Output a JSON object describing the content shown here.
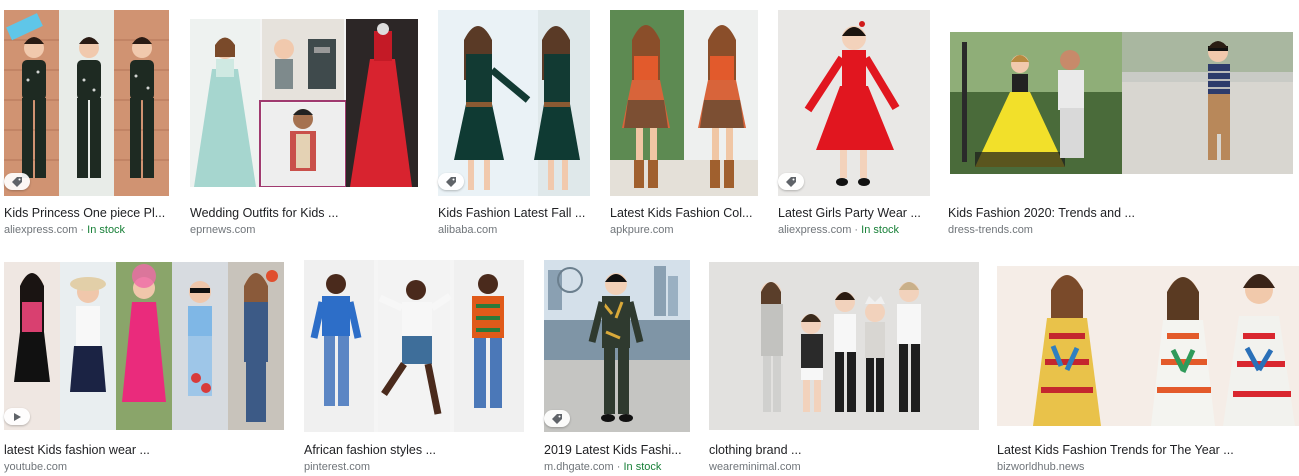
{
  "colors": {
    "title_text": "#202124",
    "source_text": "#70757a",
    "in_stock": "#188038"
  },
  "results": [
    {
      "title": "Kids Princess One piece Pl...",
      "source": "aliexpress.com",
      "availability": "In stock",
      "badge": "tag-icon"
    },
    {
      "title": "Wedding Outfits for Kids ...",
      "source": "eprnews.com"
    },
    {
      "title": "Kids Fashion Latest Fall ...",
      "source": "alibaba.com",
      "badge": "tag-icon"
    },
    {
      "title": "Latest Kids Fashion Col...",
      "source": "apkpure.com"
    },
    {
      "title": "Latest Girls Party Wear ...",
      "source": "aliexpress.com",
      "availability": "In stock",
      "badge": "tag-icon"
    },
    {
      "title": "Kids Fashion 2020: Trends and ...",
      "source": "dress-trends.com"
    },
    {
      "title": "latest Kids fashion wear ...",
      "source": "youtube.com",
      "badge": "play-icon"
    },
    {
      "title": "African fashion styles ...",
      "source": "pinterest.com"
    },
    {
      "title": "2019 Latest Kids Fashi...",
      "source": "m.dhgate.com",
      "availability": "In stock",
      "badge": "tag-icon"
    },
    {
      "title": "clothing brand ...",
      "source": "weareminimal.com"
    },
    {
      "title": "Latest Kids Fashion Trends for The Year ...",
      "source": "bizworldhub.news"
    }
  ]
}
